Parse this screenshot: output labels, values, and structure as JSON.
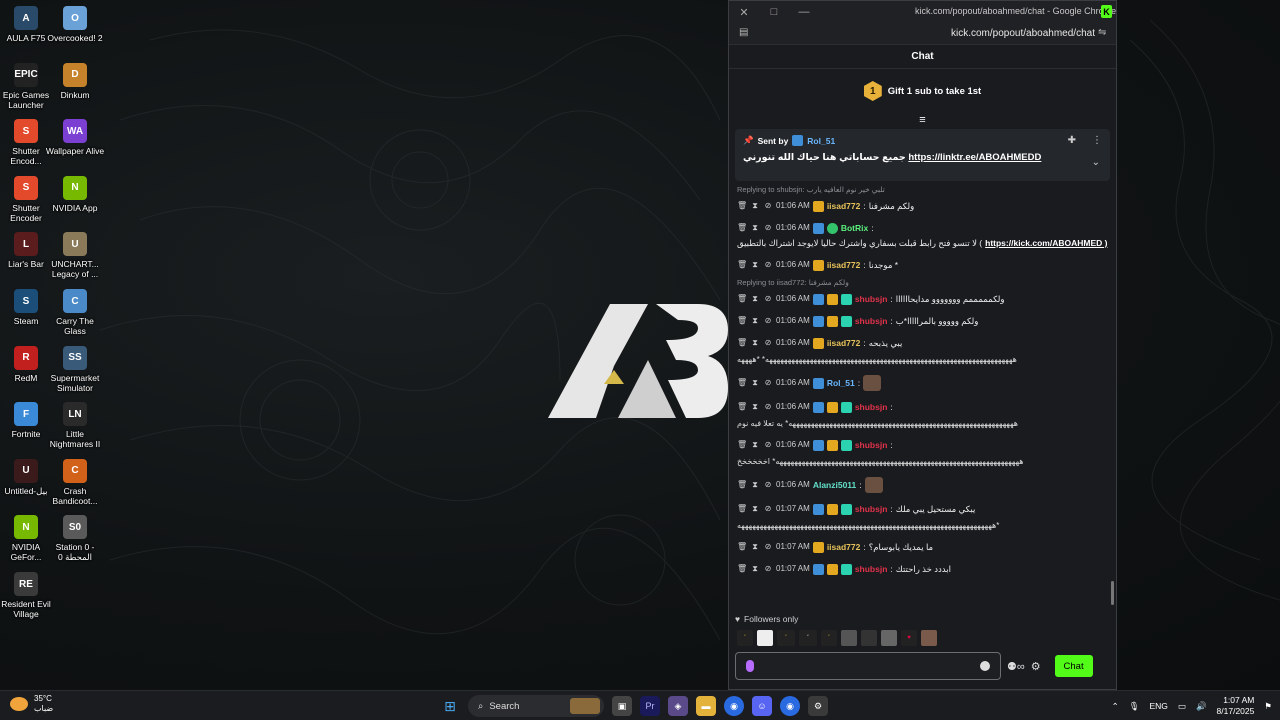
{
  "desktop": {
    "icons": [
      {
        "label": "AULA F75",
        "name": "aula-f75-icon",
        "color": "#2a4a6a",
        "glyph": "A"
      },
      {
        "label": "Overcooked! 2",
        "name": "overcooked-2-icon",
        "color": "#6aa2d8",
        "glyph": "O"
      },
      {
        "label": "Epic Games Launcher",
        "name": "epic-games-icon",
        "color": "#222",
        "glyph": "EPIC"
      },
      {
        "label": "Dinkum",
        "name": "dinkum-icon",
        "color": "#c6822a",
        "glyph": "D"
      },
      {
        "label": "Shutter Encod...",
        "name": "shutter-encoder-icon",
        "color": "#e34a2c",
        "glyph": "S"
      },
      {
        "label": "Wallpaper Alive",
        "name": "wallpaper-alive-icon",
        "color": "#7b3fd1",
        "glyph": "WA"
      },
      {
        "label": "Shutter Encoder",
        "name": "shutter-encoder-2-icon",
        "color": "#e34a2c",
        "glyph": "S"
      },
      {
        "label": "NVIDIA App",
        "name": "nvidia-app-icon",
        "color": "#76b900",
        "glyph": "N"
      },
      {
        "label": "Liar's Bar",
        "name": "liars-bar-icon",
        "color": "#5a1c1c",
        "glyph": "L"
      },
      {
        "label": "UNCHART... Legacy of ...",
        "name": "uncharted-icon",
        "color": "#8a7a5a",
        "glyph": "U"
      },
      {
        "label": "Steam",
        "name": "steam-icon",
        "color": "#1b4f7a",
        "glyph": "S"
      },
      {
        "label": "Carry The Glass",
        "name": "carry-the-glass-icon",
        "color": "#4a8ac8",
        "glyph": "C"
      },
      {
        "label": "RedM",
        "name": "redm-icon",
        "color": "#c21f1f",
        "glyph": "R"
      },
      {
        "label": "Supermarket Simulator",
        "name": "supermarket-simulator-icon",
        "color": "#3a5a7a",
        "glyph": "SS"
      },
      {
        "label": "Fortnite",
        "name": "fortnite-icon",
        "color": "#3a8ad8",
        "glyph": "F"
      },
      {
        "label": "Little Nightmares II",
        "name": "little-nightmares-icon",
        "color": "#2a2a2a",
        "glyph": "LN"
      },
      {
        "label": "Untitled-بيل",
        "name": "untitled-file-icon",
        "color": "#3a1a1a",
        "glyph": "U"
      },
      {
        "label": "Crash Bandicoot...",
        "name": "crash-bandicoot-icon",
        "color": "#d2621a",
        "glyph": "C"
      },
      {
        "label": "NVIDIA GeFor...",
        "name": "nvidia-geforce-icon",
        "color": "#76b900",
        "glyph": "N"
      },
      {
        "label": "Station 0 - المحطة 0",
        "name": "station-0-icon",
        "color": "#5a5a5a",
        "glyph": "S0"
      },
      {
        "label": "Resident Evil Village",
        "name": "resident-evil-icon",
        "color": "#3a3a3a",
        "glyph": "RE"
      }
    ]
  },
  "chrome": {
    "title": "kick.com/popout/aboahmed/chat - Google Chrome",
    "url": "kick.com/popout/aboahmed/chat"
  },
  "chat": {
    "header": "Chat",
    "gift_text": "Gift 1 sub to take 1st",
    "gift_rank": "1",
    "pinned": {
      "sent_by": "Sent by",
      "user": "Rol_51",
      "text_ar": "جميع حساباتي هنا حياك الله تنورني",
      "link": "https://linktr.ee/ABOAHMEDD"
    },
    "messages": [
      {
        "reply": "Replying to shubsjn: تلبي خير نوم العافيه يارب",
        "time": "01:06 AM",
        "user": "iisad772",
        "ucls": "u-gold",
        "badges": [
          "gold"
        ],
        "text": "ولكم مشرفنا"
      },
      {
        "time": "01:06 AM",
        "user": "BotRix",
        "ucls": "u-green",
        "badges": [
          "blue",
          "green"
        ],
        "text": "لا تنسو فتح رابط قبلت بسفاري واشترك حاليا لايوجد اشتراك بالتطبيق (",
        "link": "https://kick.com/ABOAHMED )"
      },
      {
        "time": "01:06 AM",
        "user": "iisad772",
        "ucls": "u-gold",
        "badges": [
          "gold"
        ],
        "text": "موجدنا *"
      },
      {
        "reply": "Replying to iisad772: ولكم مشرفنا",
        "time": "01:06 AM",
        "user": "shubsjn",
        "ucls": "u-red",
        "badges": [
          "blue",
          "gold",
          "teal"
        ],
        "text": "ولكمممممم ووووووو مدايحاااااا"
      },
      {
        "time": "01:06 AM",
        "user": "shubsjn",
        "ucls": "u-red",
        "badges": [
          "blue",
          "gold",
          "teal"
        ],
        "text": "ولكم ووووو بالمرااااا*ب"
      },
      {
        "time": "01:06 AM",
        "user": "iisad772",
        "ucls": "u-gold",
        "badges": [
          "gold"
        ],
        "text": "يبي يذبحه",
        "cont": "هههههههههههههههههههههههههههههههههههههههههههههههههههههههههههههههههههه* *ههههه"
      },
      {
        "time": "01:06 AM",
        "user": "Rol_51",
        "ucls": "u-blue",
        "badges": [
          "blue"
        ],
        "text": "",
        "emote": true
      },
      {
        "time": "01:06 AM",
        "user": "shubsjn",
        "ucls": "u-red",
        "badges": [
          "blue",
          "gold",
          "teal"
        ],
        "text": "",
        "cont": "هههههههههههههههههههههههههههههههههههههههههههههههههههههههههههههه* يه تعلا فيه نوم"
      },
      {
        "time": "01:06 AM",
        "user": "shubsjn",
        "ucls": "u-red",
        "badges": [
          "blue",
          "gold",
          "teal"
        ],
        "text": "",
        "cont": "ههههههههههههههههههههههههههههههههههههههههههههههههههههههههههههههههههه* اخخخخخخ"
      },
      {
        "time": "01:06 AM",
        "user": "Alanzi5011",
        "ucls": "u-teal",
        "badges": [],
        "text": "",
        "emote": true
      },
      {
        "time": "01:07 AM",
        "user": "shubsjn",
        "ucls": "u-red",
        "badges": [
          "blue",
          "gold",
          "teal"
        ],
        "text": "يبكي مستحيل يبي ملك",
        "cont": "هههههههههههههههههههههههههههههههههههههههههههههههههههههههههههههههههههههه*"
      },
      {
        "time": "01:07 AM",
        "user": "iisad772",
        "ucls": "u-gold",
        "badges": [
          "gold"
        ],
        "text": "ما يمديك يابوسام؟"
      },
      {
        "time": "01:07 AM",
        "user": "shubsjn",
        "ucls": "u-red",
        "badges": [
          "blue",
          "gold",
          "teal"
        ],
        "text": "ابددد خذ راحتتك"
      }
    ],
    "followers_only": "Followers only",
    "send_label": "Chat"
  },
  "taskbar": {
    "temp": "35°C",
    "weather": "ضباب",
    "search": "Search",
    "lang": "ENG",
    "time": "1:07 AM",
    "date": "8/17/2025"
  }
}
